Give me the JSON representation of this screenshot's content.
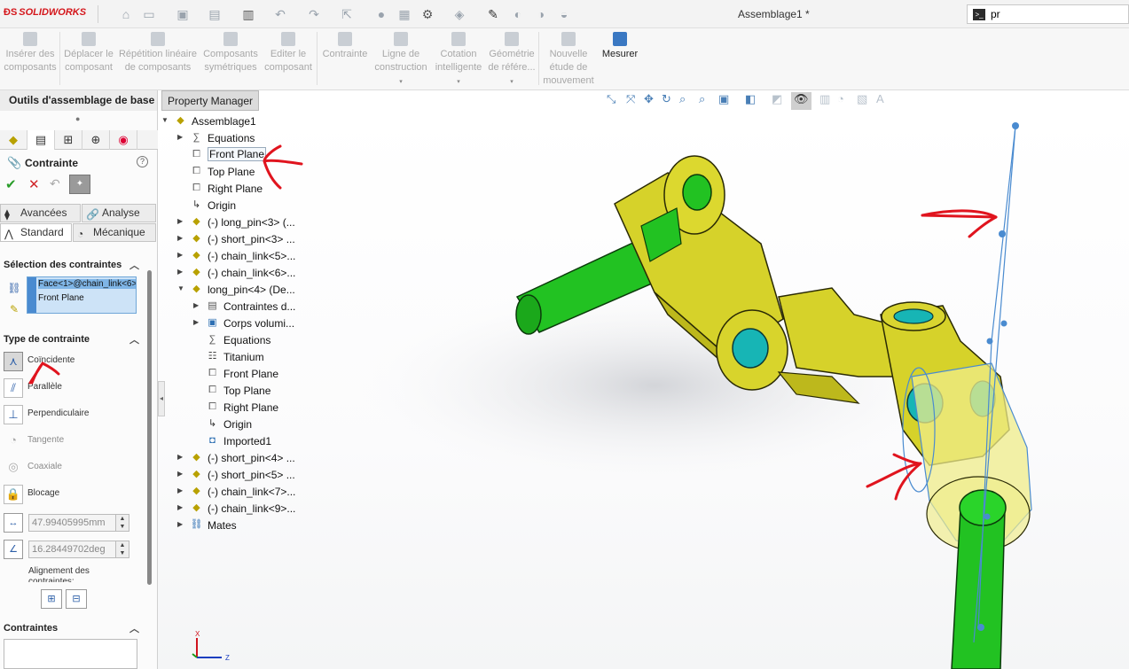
{
  "app": {
    "brand": "SOLIDWORKS",
    "document_title": "Assemblage1 *"
  },
  "search": {
    "value": "pr"
  },
  "ribbon": {
    "buttons": [
      {
        "label": "Insérer des composants",
        "enabled": false
      },
      {
        "label": "Déplacer le composant",
        "enabled": false
      },
      {
        "label": "Répétition linéaire de composants",
        "enabled": false
      },
      {
        "label": "Composants symétriques",
        "enabled": false
      },
      {
        "label": "Editer le composant",
        "enabled": false
      },
      {
        "label": "Contrainte",
        "enabled": false
      },
      {
        "label": "Ligne de construction",
        "enabled": false
      },
      {
        "label": "Cotation intelligente",
        "enabled": false
      },
      {
        "label": "Géométrie de référe...",
        "enabled": false
      },
      {
        "label": "Nouvelle étude de mouvement",
        "enabled": false
      },
      {
        "label": "Mesurer",
        "enabled": true
      }
    ]
  },
  "tabs": {
    "outils": "Outils d'assemblage de base",
    "property_manager": "Property Manager"
  },
  "panel": {
    "title": "Contrainte",
    "subtabs": {
      "avancees": "Avancées",
      "analyse": "Analyse",
      "standard": "Standard",
      "mecanique": "Mécanique"
    },
    "selection_title": "Sélection des contraintes",
    "selections": [
      "Face<1>@chain_link<6>",
      "Front Plane"
    ],
    "type_title": "Type de contrainte",
    "mate_types": [
      {
        "label": "Coïncidente",
        "icon": "coincident-icon",
        "enabled": true,
        "selected": true
      },
      {
        "label": "Parallèle",
        "icon": "parallel-icon",
        "enabled": true
      },
      {
        "label": "Perpendiculaire",
        "icon": "perpendicular-icon",
        "enabled": true
      },
      {
        "label": "Tangente",
        "icon": "tangent-icon",
        "enabled": false
      },
      {
        "label": "Coaxiale",
        "icon": "concentric-icon",
        "enabled": false
      },
      {
        "label": "Blocage",
        "icon": "lock-icon",
        "enabled": true
      }
    ],
    "distance_value": "47.99405995mm",
    "angle_value": "16.28449702deg",
    "alignment_label": "Alignement des contraintes:",
    "mates_title": "Contraintes"
  },
  "tree": {
    "root": "Assemblage1",
    "items": [
      {
        "label": "Equations",
        "icon": "equations-icon",
        "indent": 1,
        "expander": true
      },
      {
        "label": "Front Plane",
        "icon": "plane-icon",
        "indent": 1,
        "hover": true
      },
      {
        "label": "Top Plane",
        "icon": "plane-icon",
        "indent": 1
      },
      {
        "label": "Right Plane",
        "icon": "plane-icon",
        "indent": 1
      },
      {
        "label": "Origin",
        "icon": "origin-icon",
        "indent": 1
      },
      {
        "label": "(-) long_pin<3> (...",
        "icon": "part-icon",
        "indent": 1,
        "expander": true
      },
      {
        "label": "(-) short_pin<3> ...",
        "icon": "part-icon",
        "indent": 1,
        "expander": true
      },
      {
        "label": "(-) chain_link<5>...",
        "icon": "part-icon",
        "indent": 1,
        "expander": true
      },
      {
        "label": "(-) chain_link<6>...",
        "icon": "part-icon",
        "indent": 1,
        "expander": true
      },
      {
        "label": "long_pin<4> (De...",
        "icon": "part-icon",
        "indent": 1,
        "expander": true,
        "open": true
      },
      {
        "label": "Contraintes d...",
        "icon": "folder-icon",
        "indent": 2,
        "expander": true
      },
      {
        "label": "Corps volumi...",
        "icon": "solid-bodies-icon",
        "indent": 2,
        "expander": true
      },
      {
        "label": "Equations",
        "icon": "equations-icon",
        "indent": 2
      },
      {
        "label": "Titanium",
        "icon": "material-icon",
        "indent": 2
      },
      {
        "label": "Front Plane",
        "icon": "plane-icon",
        "indent": 2
      },
      {
        "label": "Top Plane",
        "icon": "plane-icon",
        "indent": 2
      },
      {
        "label": "Right Plane",
        "icon": "plane-icon",
        "indent": 2
      },
      {
        "label": "Origin",
        "icon": "origin-icon",
        "indent": 2
      },
      {
        "label": "Imported1",
        "icon": "imported-body-icon",
        "indent": 2
      },
      {
        "label": "(-) short_pin<4> ...",
        "icon": "part-icon",
        "indent": 1,
        "expander": true
      },
      {
        "label": "(-) short_pin<5> ...",
        "icon": "part-icon",
        "indent": 1,
        "expander": true
      },
      {
        "label": "(-) chain_link<7>...",
        "icon": "part-icon",
        "indent": 1,
        "expander": true
      },
      {
        "label": "(-) chain_link<9>...",
        "icon": "part-icon",
        "indent": 1,
        "expander": true
      },
      {
        "label": "Mates",
        "icon": "mates-icon",
        "indent": 1,
        "expander": true
      }
    ]
  },
  "triad": {
    "x": "X",
    "z": "Z"
  },
  "colors": {
    "part_yellow": "#d4d12a",
    "pin_green": "#1fb81f",
    "hole_cyan": "#17b5b5",
    "accent_blue": "#4a8bd0",
    "annotation_red": "#e0141e"
  }
}
